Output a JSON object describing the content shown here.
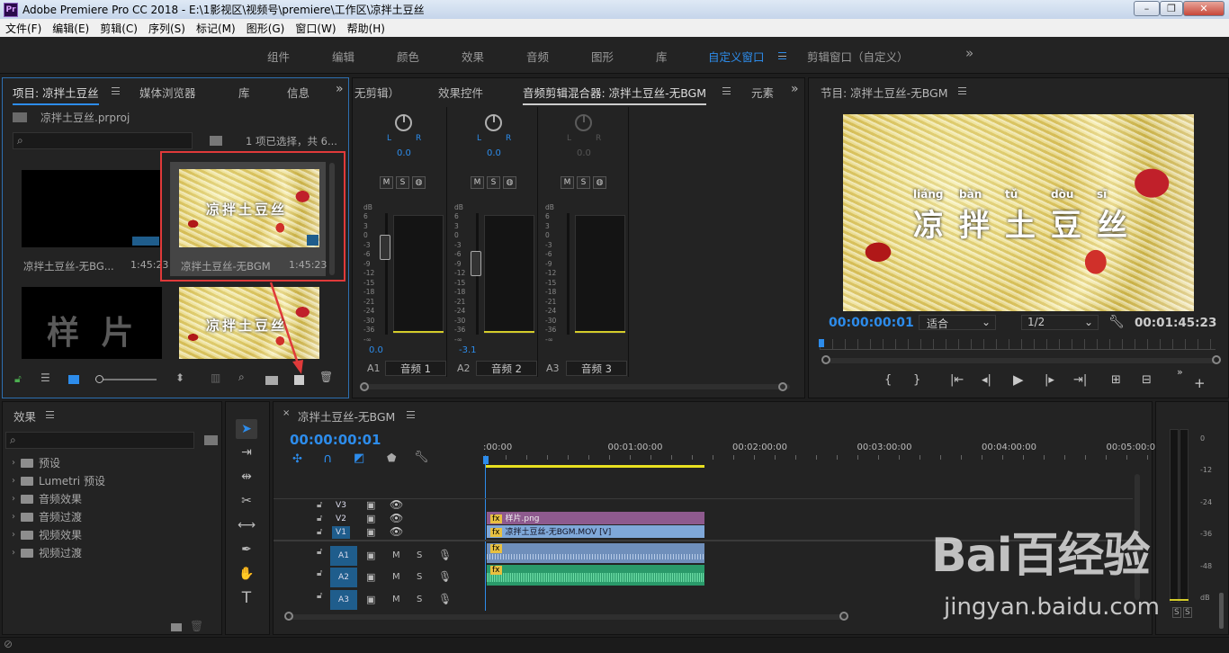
{
  "window": {
    "title": "Adobe Premiere Pro CC 2018 - E:\\1影视区\\视频号\\premiere\\工作区\\凉拌土豆丝",
    "logo": "Pr",
    "controls": [
      "–",
      "❐",
      "✕"
    ]
  },
  "menu": [
    "文件(F)",
    "编辑(E)",
    "剪辑(C)",
    "序列(S)",
    "标记(M)",
    "图形(G)",
    "窗口(W)",
    "帮助(H)"
  ],
  "workspaces": [
    "组件",
    "编辑",
    "颜色",
    "效果",
    "音频",
    "图形",
    "库",
    "自定义窗口",
    "剪辑窗口（自定义）",
    "»"
  ],
  "project": {
    "tabs": [
      "项目: 凉拌土豆丝",
      "媒体浏览器",
      "库",
      "信息",
      "»"
    ],
    "file": "凉拌土豆丝.prproj",
    "search_placeholder": "",
    "status": "1 项已选择，共 6...",
    "items": [
      {
        "name": "凉拌土豆丝-无BG...",
        "duration": "1:45:23"
      },
      {
        "name": "凉拌土豆丝-无BGM",
        "duration": "1:45:23"
      },
      {
        "name": "样 片",
        "duration": ""
      },
      {
        "name": "",
        "duration": ""
      }
    ]
  },
  "subtitle": {
    "pinyin": [
      "liáng",
      "bàn",
      "tǔ",
      "dòu",
      "sī"
    ],
    "chars": "凉拌土豆丝"
  },
  "mixer": {
    "tabs": [
      "无剪辑）",
      "效果控件",
      "音频剪辑混合器: 凉拌土豆丝-无BGM",
      "元素",
      "»"
    ],
    "channels": [
      {
        "id": "A1",
        "name": "音频 1",
        "pan": "0.0",
        "level": "0.0"
      },
      {
        "id": "A2",
        "name": "音频 2",
        "pan": "0.0",
        "level": "-3.1"
      },
      {
        "id": "A3",
        "name": "音频 3",
        "pan": "0.0",
        "level": ""
      }
    ],
    "db_label": "dB",
    "scale": [
      "6",
      "3",
      "0",
      "-3",
      "-6",
      "-9",
      "-12",
      "-15",
      "-18",
      "-21",
      "-24",
      "-30",
      "-36",
      "-∞"
    ],
    "lr": [
      "L",
      "R"
    ],
    "buttons": [
      "M",
      "S",
      "◍"
    ]
  },
  "program": {
    "title": "节目: 凉拌土豆丝-无BGM",
    "timecode": "00:00:00:01",
    "fit": "适合",
    "resolution": "1/2",
    "duration": "00:01:45:23"
  },
  "effects": {
    "title": "效果",
    "items": [
      "预设",
      "Lumetri 预设",
      "音频效果",
      "音频过渡",
      "视频效果",
      "视频过渡"
    ]
  },
  "timeline": {
    "tab": "凉拌土豆丝-无BGM",
    "timecode": "00:00:00:01",
    "ruler": [
      ":00:00",
      "00:01:00:00",
      "00:02:00:00",
      "00:03:00:00",
      "00:04:00:00",
      "00:05:00:0"
    ],
    "tracks": [
      "V3",
      "V2",
      "V1",
      "A1",
      "A2",
      "A3"
    ],
    "clips": {
      "v2": "样片.png",
      "v1": "凉拌土豆丝-无BGM.MOV [V]"
    }
  },
  "audio_meter": {
    "scale": [
      "0",
      "-12",
      "-24",
      "-36",
      "-48",
      "dB"
    ],
    "buttons": [
      "S",
      "S"
    ]
  },
  "watermark": {
    "brand": "Bai百经验",
    "url": "jingyan.baidu.com"
  },
  "colors": {
    "accent": "#2d8ceb",
    "highlight": "#e03a3a",
    "yellow": "#e8e020"
  }
}
